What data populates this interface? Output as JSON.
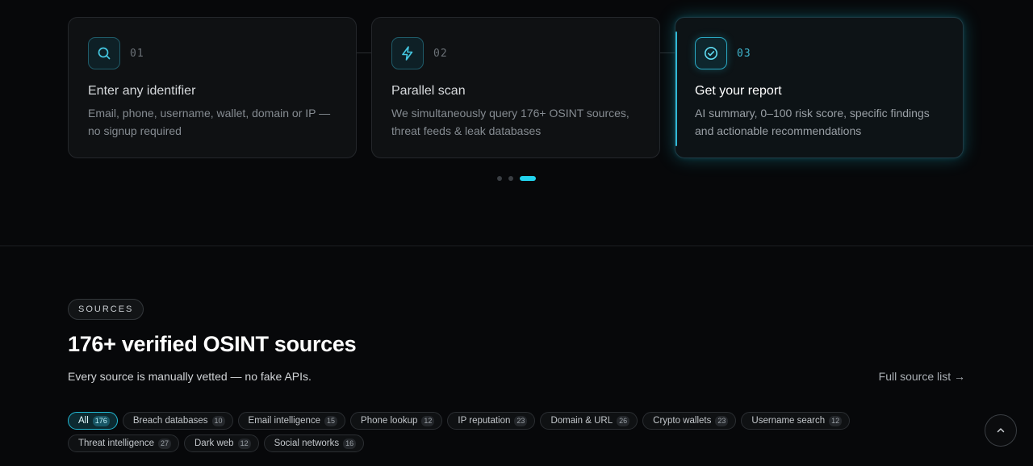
{
  "steps": [
    {
      "number": "01",
      "title": "Enter any identifier",
      "description": "Email, phone, username, wallet, domain or IP — no signup required",
      "icon": "search-icon"
    },
    {
      "number": "02",
      "title": "Parallel scan",
      "description": "We simultaneously query 176+ OSINT sources, threat feeds & leak databases",
      "icon": "lightning-icon"
    },
    {
      "number": "03",
      "title": "Get your report",
      "description": "AI summary, 0–100 risk score, specific findings and actionable recommendations",
      "icon": "check-circle-icon"
    }
  ],
  "carousel": {
    "active_index": 2,
    "total": 3
  },
  "sources": {
    "badge": "SOURCES",
    "heading": "176+ verified OSINT sources",
    "subtext": "Every source is manually vetted — no fake APIs.",
    "full_list_link": "Full source list →"
  },
  "filters": [
    {
      "label": "All",
      "count": "176"
    },
    {
      "label": "Breach databases",
      "count": "10"
    },
    {
      "label": "Email intelligence",
      "count": "15"
    },
    {
      "label": "Phone lookup",
      "count": "12"
    },
    {
      "label": "IP reputation",
      "count": "23"
    },
    {
      "label": "Domain & URL",
      "count": "26"
    },
    {
      "label": "Crypto wallets",
      "count": "23"
    },
    {
      "label": "Username search",
      "count": "12"
    },
    {
      "label": "Threat intelligence",
      "count": "27"
    },
    {
      "label": "Dark web",
      "count": "12"
    },
    {
      "label": "Social networks",
      "count": "16"
    }
  ],
  "active_filter": "All",
  "colors": {
    "accent": "#22d3ee",
    "background": "#07080a"
  },
  "scroll_top_icon": "chevron-up-icon"
}
